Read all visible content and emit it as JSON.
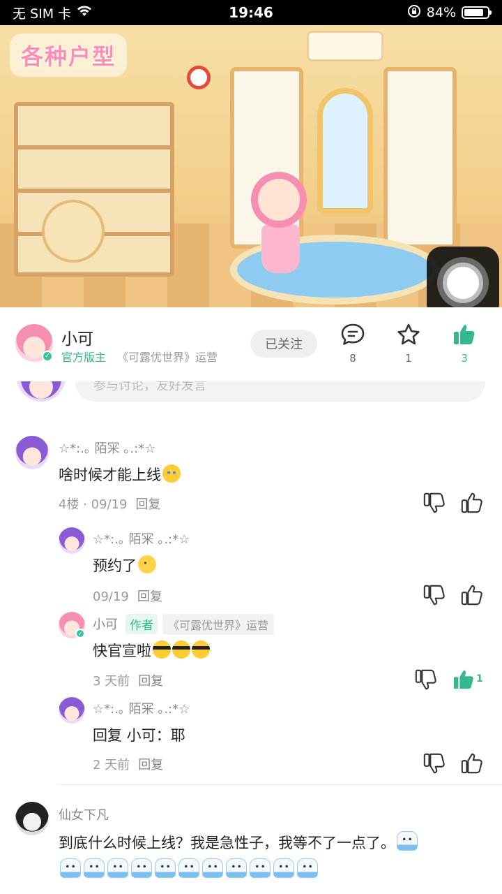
{
  "status_bar": {
    "carrier": "无 SIM 卡",
    "time": "19:46",
    "battery_percent": "84%",
    "battery_level": 0.84
  },
  "banner": {
    "tag": "各种户型"
  },
  "author": {
    "name": "小可",
    "role": "官方版主",
    "desc": "《可露优世界》运营",
    "follow_label": "已关注",
    "stats": {
      "comments": "8",
      "favorites": "1",
      "likes": "3"
    },
    "accent_color": "#35b88e"
  },
  "comment_input": {
    "placeholder": "参与讨论，友好发言"
  },
  "comments": [
    {
      "user": "☆*:.｡ 陌冞 ｡.:*☆",
      "text": "啥时候才能上线",
      "emoji": "loudly-crying-emoji",
      "floor": "4楼",
      "date": "09/19",
      "reply_label": "回复",
      "replies": [
        {
          "user": "☆*:.｡ 陌冞 ｡.:*☆",
          "text": "预约了",
          "emoji": "wink-emoji",
          "date": "09/19",
          "reply_label": "回复"
        },
        {
          "user": "小可",
          "author_tag": "作者",
          "role_tag": "《可露优世界》运营",
          "text": "快官宣啦",
          "emoji": "sunglasses-emoji",
          "date": "3 天前",
          "reply_label": "回复",
          "like_count": "1"
        },
        {
          "user": "☆*:.｡ 陌冞 ｡.:*☆",
          "text": "回复 小可：耶",
          "date": "2 天前",
          "reply_label": "回复"
        }
      ]
    },
    {
      "user": "仙女下凡",
      "text": "到底什么时候上线？我是急性子，我等不了一点了。",
      "emoji": "ghost-emoji"
    }
  ]
}
